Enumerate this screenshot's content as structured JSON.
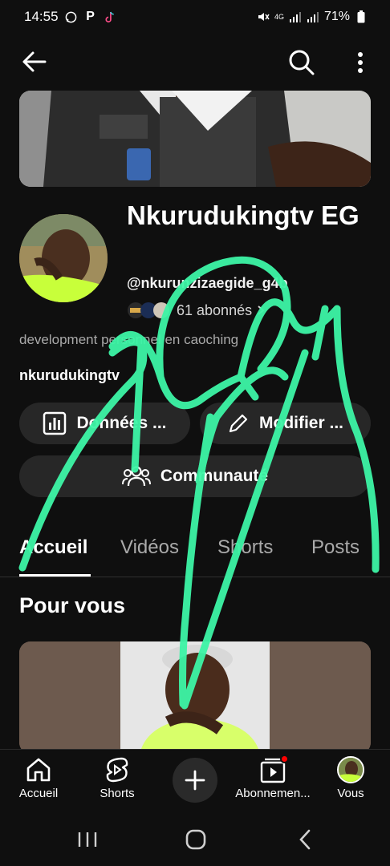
{
  "status": {
    "time": "14:55",
    "battery": "71%",
    "network": "4G"
  },
  "channel": {
    "name": "Nkurudukingtv EG",
    "handle": "@nkurunzizaegide_g4b",
    "subscribers": "61 abonnés",
    "description": "development personnel en caoching",
    "link": "nkurudukingtv"
  },
  "actions": {
    "data_label": "Données ...",
    "edit_label": "Modifier ...",
    "community_label": "Communauté"
  },
  "tabs": [
    "Accueil",
    "Vidéos",
    "Shorts",
    "Posts"
  ],
  "section": {
    "title": "Pour vous"
  },
  "bottom_nav": {
    "home": "Accueil",
    "shorts": "Shorts",
    "subscriptions": "Abonnemen...",
    "you": "Vous"
  },
  "colors": {
    "background": "#0f0f0f",
    "pill": "#272727",
    "scribble": "#3df5a6",
    "notification": "#ff0000"
  }
}
